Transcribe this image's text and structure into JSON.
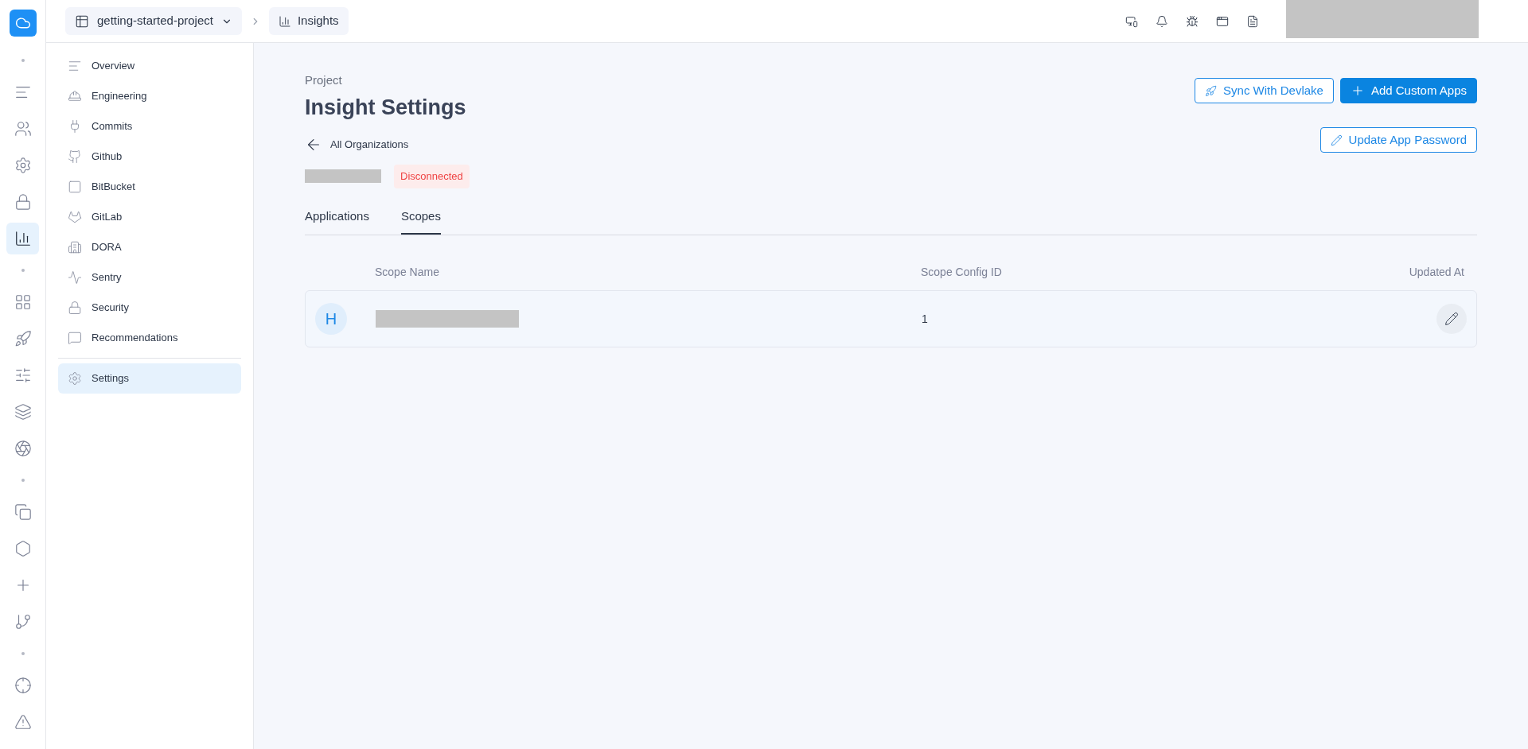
{
  "topbar": {
    "project": "getting-started-project",
    "breadcrumb": "Insights"
  },
  "rail": [
    {
      "kind": "dot"
    },
    {
      "kind": "button",
      "selected": false
    },
    {
      "kind": "button",
      "selected": false
    },
    {
      "kind": "button",
      "selected": false
    },
    {
      "kind": "button",
      "selected": false
    },
    {
      "kind": "button",
      "selected": true
    },
    {
      "kind": "dot"
    },
    {
      "kind": "button",
      "selected": false
    },
    {
      "kind": "button",
      "selected": false
    },
    {
      "kind": "button",
      "selected": false
    },
    {
      "kind": "button",
      "selected": false
    },
    {
      "kind": "button",
      "selected": false
    },
    {
      "kind": "dot"
    },
    {
      "kind": "button",
      "selected": false
    },
    {
      "kind": "button",
      "selected": false
    },
    {
      "kind": "button",
      "selected": false
    },
    {
      "kind": "button",
      "selected": false
    },
    {
      "kind": "dot"
    },
    {
      "kind": "button",
      "selected": false
    },
    {
      "kind": "button",
      "selected": false
    }
  ],
  "sidebar": {
    "items": [
      {
        "label": "Overview",
        "selected": false
      },
      {
        "label": "Engineering",
        "selected": false
      },
      {
        "label": "Commits",
        "selected": false
      },
      {
        "label": "Github",
        "selected": false
      },
      {
        "label": "BitBucket",
        "selected": false
      },
      {
        "label": "GitLab",
        "selected": false
      },
      {
        "label": "DORA",
        "selected": false
      },
      {
        "label": "Sentry",
        "selected": false
      },
      {
        "label": "Security",
        "selected": false
      },
      {
        "label": "Recommendations",
        "selected": false
      }
    ],
    "footer_items": [
      {
        "label": "Settings",
        "selected": true
      }
    ]
  },
  "header": {
    "eyebrow": "Project",
    "title": "Insight Settings",
    "back_link": "All Organizations",
    "status": "Disconnected"
  },
  "actions": [
    {
      "label": "Sync With Devlake",
      "kind": "outline"
    },
    {
      "label": "Add Custom Apps",
      "kind": "primary"
    }
  ],
  "secondary_action": {
    "label": "Update App Password"
  },
  "tabs": [
    {
      "label": "Applications",
      "selected": false
    },
    {
      "label": "Scopes",
      "selected": true
    }
  ],
  "table": {
    "columns": [
      "Scope Name",
      "Scope Config ID",
      "Updated At"
    ],
    "rows": [
      {
        "avatar": "H",
        "scope_config_id": "1"
      }
    ]
  }
}
